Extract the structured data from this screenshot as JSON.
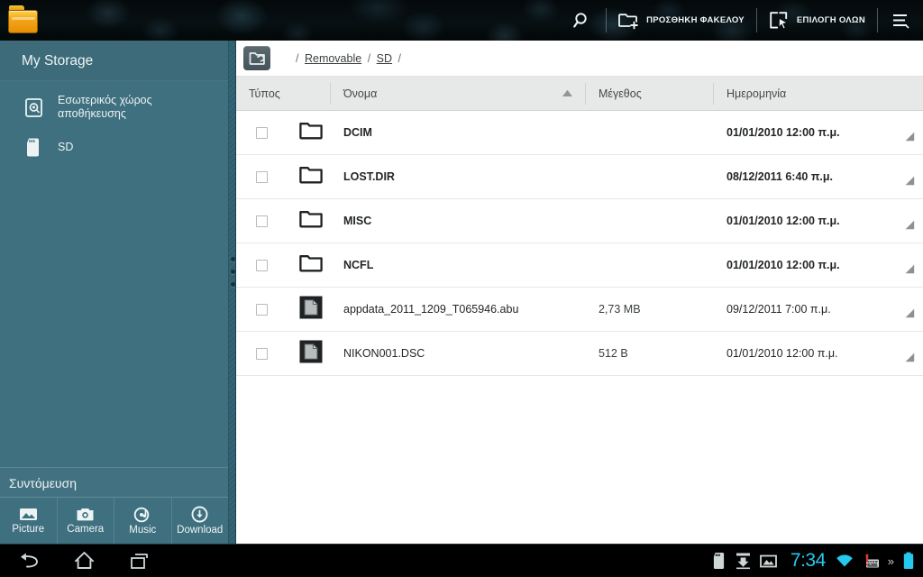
{
  "topbar": {
    "app_icon": "folder-app-icon",
    "search_icon": "search-icon",
    "add_folder": {
      "label": "ΠΡΟΣΘΗΚΗ ΦΑΚΕΛΟΥ",
      "icon": "add-folder-icon"
    },
    "select_all": {
      "label": "ΕΠΙΛΟΓΗ ΟΛΩΝ",
      "icon": "select-all-icon"
    },
    "menu_icon": "menu-icon"
  },
  "sidebar": {
    "title": "My Storage",
    "items": [
      {
        "label": "Εσωτερικός χώρος\nαποθήκευσης",
        "icon": "internal-storage-icon"
      },
      {
        "label": "SD",
        "icon": "sd-card-icon"
      }
    ],
    "shortcut": {
      "title": "Συντόμευση",
      "items": [
        {
          "label": "Picture",
          "icon": "picture-icon"
        },
        {
          "label": "Camera",
          "icon": "camera-icon"
        },
        {
          "label": "Music",
          "icon": "music-icon"
        },
        {
          "label": "Download",
          "icon": "download-icon"
        }
      ]
    }
  },
  "main": {
    "up_button_icon": "folder-up-icon",
    "breadcrumb": {
      "root": "/",
      "parts": [
        "Removable",
        "SD"
      ],
      "trailing": "/"
    },
    "columns": {
      "type": "Τύπος",
      "name": "Όνομα",
      "size": "Μέγεθος",
      "date": "Ημερομηνία",
      "sorted_by": "name",
      "sort_direction": "ascending"
    },
    "rows": [
      {
        "checked": false,
        "icon": "folder-icon",
        "name": "DCIM",
        "size": "",
        "date": "01/01/2010 12:00 π.μ.",
        "bold": true
      },
      {
        "checked": false,
        "icon": "folder-icon",
        "name": "LOST.DIR",
        "size": "",
        "date": "08/12/2011 6:40 π.μ.",
        "bold": true
      },
      {
        "checked": false,
        "icon": "folder-icon",
        "name": "MISC",
        "size": "",
        "date": "01/01/2010 12:00 π.μ.",
        "bold": true
      },
      {
        "checked": false,
        "icon": "folder-icon",
        "name": "NCFL",
        "size": "",
        "date": "01/01/2010 12:00 π.μ.",
        "bold": true
      },
      {
        "checked": false,
        "icon": "file-icon",
        "name": "appdata_2011_1209_T065946.abu",
        "size": "2,73 MB",
        "date": "09/12/2011 7:00 π.μ.",
        "bold": false
      },
      {
        "checked": false,
        "icon": "file-icon",
        "name": "NIKON001.DSC",
        "size": "512 B",
        "date": "01/01/2010 12:00 π.μ.",
        "bold": false
      }
    ]
  },
  "navbar": {
    "back_icon": "back-icon",
    "home_icon": "home-icon",
    "recents_icon": "recent-apps-icon",
    "status_icons": [
      "sd-card-status-icon",
      "download-status-icon",
      "screenshot-status-icon"
    ],
    "clock": "7:34",
    "wifi_icon": "wifi-icon",
    "keyboard_icon": "keyboard-alert-icon",
    "more_indicator": "»",
    "battery_icon": "battery-icon"
  },
  "colors": {
    "sidebar": "#3f707f",
    "topbar": "#050a0c",
    "accent_clock": "#27c8ee",
    "header_row": "#e7e9e9"
  }
}
